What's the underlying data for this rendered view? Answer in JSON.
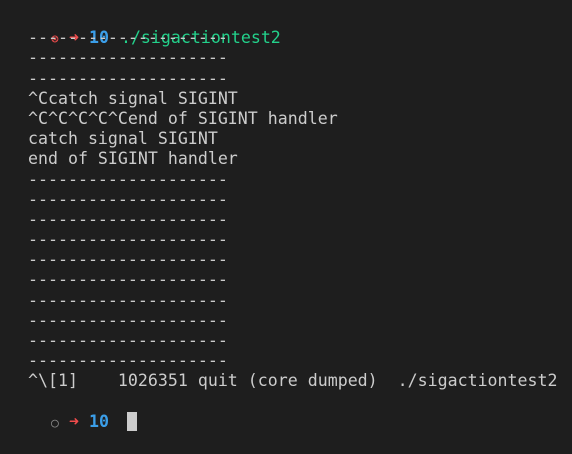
{
  "terminal": {
    "prompt1": {
      "status_icon": "⊗",
      "status_icon_name": "error-status-icon",
      "arrow": "➜",
      "cwd": "10",
      "command": "./sigactiontest2"
    },
    "output": [
      "--------------------",
      "--------------------",
      "--------------------",
      "^Ccatch signal SIGINT",
      "^C^C^C^C^Cend of SIGINT handler",
      "catch signal SIGINT",
      "end of SIGINT handler",
      "--------------------",
      "--------------------",
      "--------------------",
      "--------------------",
      "--------------------",
      "--------------------",
      "--------------------",
      "--------------------",
      "--------------------",
      "--------------------"
    ],
    "job_line": "^\\[1]    1026351 quit (core dumped)  ./sigactiontest2",
    "prompt2": {
      "status_icon": "○",
      "status_icon_name": "neutral-status-icon",
      "arrow": "➜",
      "cwd": "10"
    },
    "colors": {
      "background": "#1e1e1e",
      "text": "#cccccc",
      "error": "#f14c4c",
      "cwd": "#3b9ee8",
      "command": "#23d18b"
    }
  }
}
